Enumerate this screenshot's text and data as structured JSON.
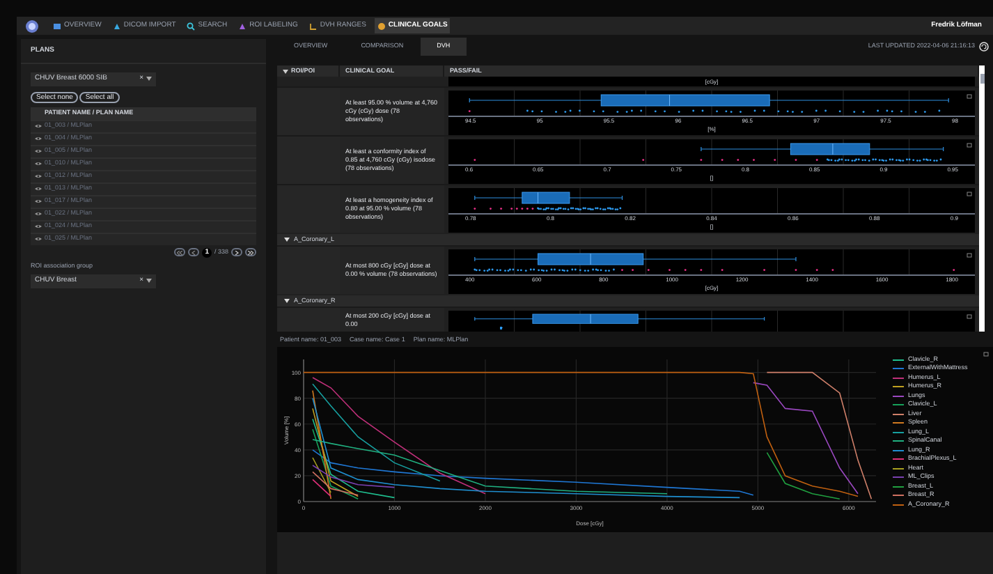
{
  "nav": {
    "items": [
      {
        "label": "OVERVIEW",
        "selected": false
      },
      {
        "label": "DICOM IMPORT",
        "selected": false
      },
      {
        "label": "SEARCH",
        "selected": false
      },
      {
        "label": "ROI LABELING",
        "selected": false
      },
      {
        "label": "DVH RANGES",
        "selected": false
      },
      {
        "label": "CLINICAL GOALS",
        "selected": true
      }
    ],
    "user": "Fredrik Löfman"
  },
  "plans_panel": {
    "title": "PLANS",
    "plan_set": "CHUV Breast 6000 SIB",
    "clear": "×",
    "buttons": [
      "Select none",
      "Select all"
    ],
    "column": "PATIENT NAME / PLAN NAME",
    "rows": [
      "01_003 / MLPlan",
      "01_004 / MLPlan",
      "01_005 / MLPlan",
      "01_010 / MLPlan",
      "01_012 / MLPlan",
      "01_013 / MLPlan",
      "01_017 / MLPlan",
      "01_022 / MLPlan",
      "01_024 / MLPlan",
      "01_025 / MLPlan"
    ],
    "pagination": {
      "page": "1",
      "total": "/ 338"
    },
    "roi_group_label": "ROI association group",
    "roi_group": "CHUV Breast",
    "roi_group_clear": "×"
  },
  "tabs": [
    {
      "label": "OVERVIEW",
      "selected": false
    },
    {
      "label": "COMPARISON",
      "selected": false
    },
    {
      "label": "DVH",
      "selected": true
    }
  ],
  "last_updated": "LAST UPDATED 2022-04-06 21:16:13",
  "goals_table": {
    "columns": [
      "ROI/POI",
      "CLINICAL GOAL",
      "PASS/FAIL"
    ],
    "top_axis_label": "[cGy]",
    "rows": [
      {
        "kind": "goal",
        "goal": "At least 95.00 % volume at 4,760 cGy (cGy) dose (78 observations)",
        "ticks": [
          "94.5",
          "95",
          "95.5",
          "96",
          "96.5",
          "97",
          "97.5",
          "98"
        ],
        "axis_label": "[%]"
      },
      {
        "kind": "goal",
        "goal": "At least a conformity index of 0.85 at 4,760 cGy (cGy) isodose (78 observations)",
        "ticks": [
          "0.6",
          "0.65",
          "0.7",
          "0.75",
          "0.8",
          "0.85",
          "0.9",
          "0.95"
        ],
        "axis_label": "[]"
      },
      {
        "kind": "goal",
        "goal": "At least a homogeneity index of 0.80 at 95.00 % volume (78 observations)",
        "ticks": [
          "0.78",
          "0.8",
          "0.82",
          "0.84",
          "0.86",
          "0.88",
          "0.9"
        ],
        "axis_label": "[]"
      },
      {
        "kind": "roi",
        "name": "A_Coronary_L",
        "expanded": true
      },
      {
        "kind": "goal",
        "goal": "At most 800 cGy [cGy] dose at 0.00 % volume (78 observations)",
        "ticks": [
          "400",
          "600",
          "800",
          "1000",
          "1200",
          "1400",
          "1600",
          "1800"
        ],
        "axis_label": "[cGy]"
      },
      {
        "kind": "roi",
        "name": "A_Coronary_R",
        "expanded": true
      },
      {
        "kind": "goal",
        "goal": "At most 200 cGy [cGy] dose at 0.00"
      }
    ]
  },
  "status_line": [
    "Patient name: 01_003",
    "Case name: Case 1",
    "Plan name: MLPlan"
  ],
  "dvh": {
    "chart_data": {
      "type": "line",
      "xlabel": "Dose [cGy]",
      "ylabel": "Volume [%]",
      "x": [
        0,
        100,
        300,
        600,
        1000,
        1500,
        2000,
        3000,
        4000,
        4800,
        4950,
        5100,
        5300,
        5600,
        5900,
        6100,
        6250
      ],
      "xlim": [
        0,
        6300
      ],
      "ylim": [
        0,
        110
      ],
      "xticks": [
        0,
        1000,
        2000,
        3000,
        4000,
        5000,
        6000
      ],
      "yticks": [
        0,
        20,
        40,
        60,
        80,
        100
      ],
      "grid": true,
      "legend": "right",
      "series": [
        {
          "name": "Clavicle_R",
          "color": "#1fbf8f",
          "values": [
            null,
            64,
            21,
            8,
            3,
            null,
            null,
            null,
            null,
            null,
            null,
            null,
            null,
            null,
            null,
            null,
            null
          ]
        },
        {
          "name": "ExternalWithMattress",
          "color": "#1f77d4",
          "values": [
            null,
            40,
            30,
            26,
            23,
            20,
            18,
            15,
            11,
            8,
            5,
            null,
            null,
            null,
            null,
            null,
            null
          ]
        },
        {
          "name": "Humerus_L",
          "color": "#c0307a",
          "values": [
            null,
            96,
            88,
            66,
            46,
            22,
            6,
            null,
            null,
            null,
            null,
            null,
            null,
            null,
            null,
            null,
            null
          ]
        },
        {
          "name": "Humerus_R",
          "color": "#c0a020",
          "values": [
            null,
            72,
            16,
            4,
            null,
            null,
            null,
            null,
            null,
            null,
            null,
            null,
            null,
            null,
            null,
            null,
            null
          ]
        },
        {
          "name": "Lungs",
          "color": "#9a48c0",
          "values": [
            null,
            null,
            null,
            null,
            null,
            null,
            null,
            null,
            null,
            null,
            92,
            90,
            72,
            70,
            26,
            6,
            null
          ]
        },
        {
          "name": "Clavicle_L",
          "color": "#16a05a",
          "values": [
            null,
            56,
            12,
            2,
            null,
            null,
            null,
            null,
            null,
            null,
            null,
            null,
            null,
            null,
            null,
            null,
            null
          ]
        },
        {
          "name": "Liver",
          "color": "#d0806a",
          "values": [
            null,
            null,
            null,
            null,
            null,
            null,
            null,
            null,
            null,
            null,
            null,
            100,
            100,
            100,
            84,
            32,
            2
          ]
        },
        {
          "name": "Spleen",
          "color": "#d07a20",
          "values": [
            null,
            86,
            2,
            null,
            null,
            null,
            null,
            null,
            null,
            null,
            null,
            null,
            null,
            null,
            null,
            null,
            null
          ]
        },
        {
          "name": "Lung_L",
          "color": "#17a0a0",
          "values": [
            null,
            91,
            74,
            50,
            30,
            16,
            null,
            null,
            null,
            null,
            null,
            null,
            null,
            null,
            null,
            null,
            null
          ]
        },
        {
          "name": "SpinalCanal",
          "color": "#20b080",
          "values": [
            null,
            48,
            45,
            41,
            36,
            24,
            12,
            8,
            6,
            null,
            null,
            null,
            null,
            null,
            null,
            null,
            null
          ]
        },
        {
          "name": "Lung_R",
          "color": "#1f8fd0",
          "values": [
            null,
            80,
            26,
            17,
            13,
            10,
            8,
            6,
            4,
            3,
            null,
            null,
            null,
            null,
            null,
            null,
            null
          ]
        },
        {
          "name": "BrachialPlexus_L",
          "color": "#e0307a",
          "values": [
            null,
            17,
            4,
            null,
            null,
            null,
            null,
            null,
            null,
            null,
            null,
            null,
            null,
            null,
            null,
            null,
            null
          ]
        },
        {
          "name": "Heart",
          "color": "#a8a020",
          "values": [
            null,
            34,
            7,
            null,
            null,
            null,
            null,
            null,
            null,
            null,
            null,
            null,
            null,
            null,
            null,
            null,
            null
          ]
        },
        {
          "name": "ML_Clips",
          "color": "#7a40b0",
          "values": [
            null,
            28,
            19,
            13,
            11,
            null,
            null,
            null,
            null,
            null,
            null,
            null,
            null,
            null,
            null,
            null,
            null
          ]
        },
        {
          "name": "Breast_L",
          "color": "#20a040",
          "values": [
            null,
            null,
            null,
            null,
            null,
            null,
            null,
            null,
            null,
            null,
            null,
            38,
            14,
            6,
            2,
            null,
            null
          ]
        },
        {
          "name": "Breast_R",
          "color": "#d07060",
          "values": [
            null,
            23,
            10,
            5,
            null,
            null,
            null,
            null,
            null,
            null,
            null,
            null,
            null,
            null,
            null,
            null,
            null
          ]
        },
        {
          "name": "A_Coronary_R",
          "color": "#c06010",
          "values": [
            100,
            100,
            100,
            100,
            100,
            100,
            100,
            100,
            100,
            100,
            99,
            50,
            20,
            12,
            8,
            4,
            null
          ]
        }
      ]
    }
  }
}
